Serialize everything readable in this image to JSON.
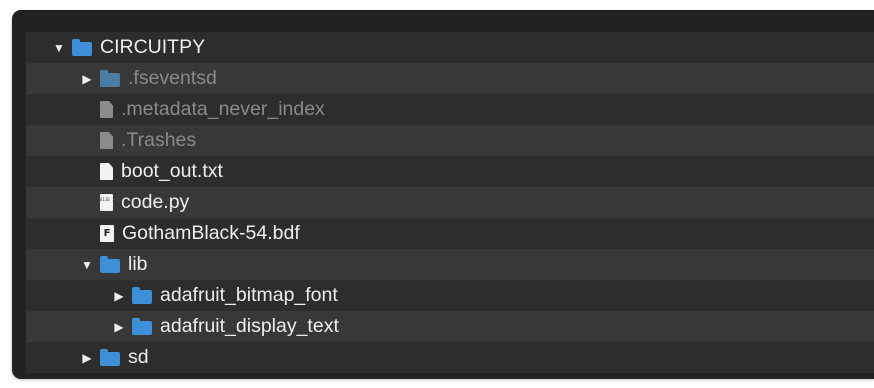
{
  "tree": {
    "root": {
      "label": "CIRCUITPY",
      "icon": "folder-icon",
      "state": "expanded"
    },
    "items": [
      {
        "label": ".fseventsd",
        "icon": "folder-icon",
        "state": "collapsed",
        "hidden": true
      },
      {
        "label": ".metadata_never_index",
        "icon": "file-icon",
        "hidden": true
      },
      {
        "label": ".Trashes",
        "icon": "file-icon",
        "hidden": true
      },
      {
        "label": "boot_out.txt",
        "icon": "file-icon"
      },
      {
        "label": "code.py",
        "icon": "code-file-icon"
      },
      {
        "label": "GothamBlack-54.bdf",
        "icon": "font-file-icon"
      },
      {
        "label": "lib",
        "icon": "folder-icon",
        "state": "expanded",
        "children": [
          {
            "label": "adafruit_bitmap_font",
            "icon": "folder-icon",
            "state": "collapsed"
          },
          {
            "label": "adafruit_display_text",
            "icon": "folder-icon",
            "state": "collapsed"
          }
        ]
      },
      {
        "label": "sd",
        "icon": "folder-icon",
        "state": "collapsed"
      }
    ]
  },
  "glyphs": {
    "expanded": "▼",
    "collapsed": "▶",
    "code_icon_text": "0110 1010",
    "font_icon_text": "F"
  },
  "colors": {
    "background": "#222222",
    "row_alt_dark": "#2d2d2d",
    "row_alt_light": "#383838",
    "folder": "#3d8fd8",
    "text": "#eeeeee",
    "text_hidden": "#8a8a8a"
  }
}
